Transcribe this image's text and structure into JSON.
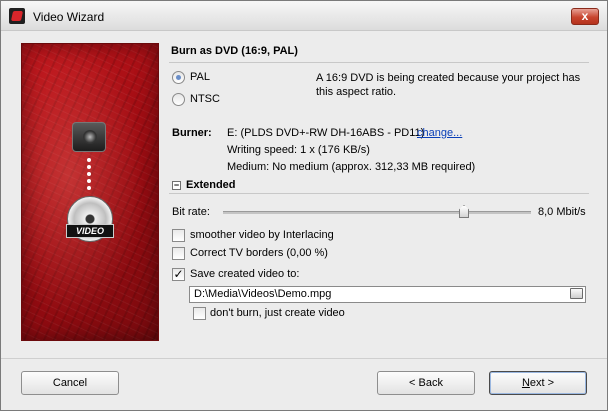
{
  "window": {
    "title": "Video Wizard",
    "close_glyph": "x"
  },
  "side_image": {
    "badge_text": "VIDEO",
    "icons": [
      "video-camera-icon",
      "dvd-disc-icon"
    ]
  },
  "heading": "Burn as DVD (16:9, PAL)",
  "video_format": {
    "options": [
      {
        "label": "PAL",
        "selected": true
      },
      {
        "label": "NTSC",
        "selected": false
      }
    ],
    "description": "A 16:9 DVD is being created because your project has this aspect ratio."
  },
  "burner": {
    "label": "Burner:",
    "device": "E: (PLDS DVD+-RW DH-16ABS - PD11)",
    "change_link": "change...",
    "writing_speed": "Writing speed: 1 x (176 KB/s)",
    "medium": "Medium: No medium (approx. 312,33 MB required)"
  },
  "extended": {
    "toggle_glyph": "−",
    "title": "Extended",
    "bitrate_label": "Bit rate:",
    "bitrate_value": "8,0 Mbit/s",
    "bitrate_fraction": 0.77,
    "options": [
      {
        "label": "smoother video by Interlacing",
        "checked": false
      },
      {
        "label": "Correct TV borders (0,00 %)",
        "checked": false
      },
      {
        "label": "Save created video to:",
        "checked": true
      }
    ],
    "save_path": "D:\\Media\\Videos\\Demo.mpg",
    "dont_burn_label": "don't burn, just create video",
    "dont_burn_checked": false,
    "check_glyph": "✓"
  },
  "buttons": {
    "cancel": "Cancel",
    "back": "< Back",
    "next": "Next >"
  },
  "colors": {
    "accent_red": "#c2161c",
    "link_blue": "#0a3fb8"
  }
}
